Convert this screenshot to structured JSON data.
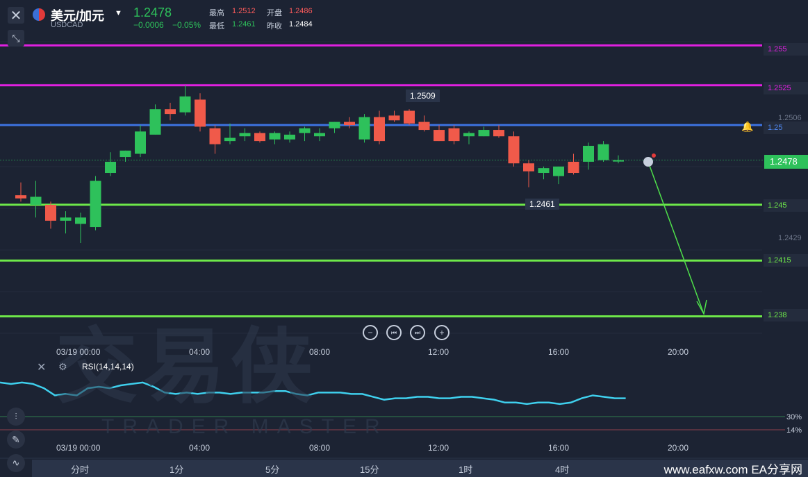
{
  "header": {
    "pair": "美元/加元",
    "symbol": "USDCAD",
    "price": "1.2478",
    "change": "−0.0006",
    "change_pct": "−0.05%",
    "high_label": "最高",
    "high_value": "1.2512",
    "open_label": "开盘",
    "open_value": "1.2486",
    "low_label": "最低",
    "low_value": "1.2461",
    "prev_label": "昨收",
    "prev_value": "1.2484"
  },
  "toolbar": {
    "close_icon": "close-icon",
    "collapse_icon": "collapse-arrows-icon"
  },
  "levels": [
    {
      "label": "1.255",
      "value": 1.255,
      "color": "#e020e0"
    },
    {
      "label": "1.2525",
      "value": 1.2525,
      "color": "#e020e0"
    },
    {
      "label": "1.25",
      "value": 1.25,
      "color": "#3d73e0"
    },
    {
      "label": "1.245",
      "value": 1.245,
      "color": "#6ee84a"
    },
    {
      "label": "1.2415",
      "value": 1.2415,
      "color": "#6ee84a"
    },
    {
      "label": "1.238",
      "value": 1.238,
      "color": "#6ee84a"
    }
  ],
  "price_axis": {
    "tick_1": "1.2506",
    "tick_2": "1.2429",
    "current": "1.2478"
  },
  "annotations": {
    "high": "1.2509",
    "low": "1.2461"
  },
  "time_axis": [
    "03/19 00:00",
    "04:00",
    "08:00",
    "12:00",
    "16:00",
    "20:00"
  ],
  "nav_buttons": [
    "zoom-out",
    "prev",
    "next",
    "zoom-in"
  ],
  "rsi": {
    "label": "RSI(14,14,14)",
    "level_30": "30%",
    "level_14": "14%"
  },
  "tabs": [
    "分时",
    "1分",
    "5分",
    "15分",
    "1时",
    "4时"
  ],
  "watermark": {
    "main": "交易侠",
    "sub": "TRADER MASTER"
  },
  "site": "www.eafxw.com   EA分享网",
  "colors": {
    "up": "#2ec15b",
    "down": "#f05a4a",
    "background": "#1c2333",
    "rsi_line": "#3fd0ee"
  },
  "chart_data": {
    "type": "candlestick",
    "ylim": [
      1.2365,
      1.2565
    ],
    "candles": [
      {
        "o": 1.2456,
        "h": 1.2464,
        "l": 1.2452,
        "c": 1.2454
      },
      {
        "o": 1.245,
        "h": 1.2465,
        "l": 1.2442,
        "c": 1.2455
      },
      {
        "o": 1.245,
        "h": 1.2452,
        "l": 1.2435,
        "c": 1.244
      },
      {
        "o": 1.244,
        "h": 1.2446,
        "l": 1.2432,
        "c": 1.2442
      },
      {
        "o": 1.2438,
        "h": 1.2445,
        "l": 1.2426,
        "c": 1.2442
      },
      {
        "o": 1.2436,
        "h": 1.2468,
        "l": 1.2434,
        "c": 1.2465
      },
      {
        "o": 1.247,
        "h": 1.2483,
        "l": 1.2468,
        "c": 1.2477
      },
      {
        "o": 1.248,
        "h": 1.2484,
        "l": 1.2477,
        "c": 1.2484
      },
      {
        "o": 1.2482,
        "h": 1.25,
        "l": 1.248,
        "c": 1.2496
      },
      {
        "o": 1.2494,
        "h": 1.2513,
        "l": 1.2494,
        "c": 1.251
      },
      {
        "o": 1.251,
        "h": 1.2514,
        "l": 1.2503,
        "c": 1.2507
      },
      {
        "o": 1.2508,
        "h": 1.2525,
        "l": 1.2506,
        "c": 1.2518
      },
      {
        "o": 1.2516,
        "h": 1.252,
        "l": 1.2496,
        "c": 1.2499
      },
      {
        "o": 1.2498,
        "h": 1.25,
        "l": 1.2482,
        "c": 1.2488
      },
      {
        "o": 1.249,
        "h": 1.2501,
        "l": 1.2488,
        "c": 1.2492
      },
      {
        "o": 1.2493,
        "h": 1.2498,
        "l": 1.249,
        "c": 1.2495
      },
      {
        "o": 1.2495,
        "h": 1.2496,
        "l": 1.2489,
        "c": 1.249
      },
      {
        "o": 1.2491,
        "h": 1.2496,
        "l": 1.2488,
        "c": 1.2495
      },
      {
        "o": 1.2491,
        "h": 1.2496,
        "l": 1.2489,
        "c": 1.2494
      },
      {
        "o": 1.2495,
        "h": 1.2499,
        "l": 1.249,
        "c": 1.2498
      },
      {
        "o": 1.2493,
        "h": 1.2498,
        "l": 1.249,
        "c": 1.2495
      },
      {
        "o": 1.2498,
        "h": 1.2502,
        "l": 1.2495,
        "c": 1.2502
      },
      {
        "o": 1.2502,
        "h": 1.2505,
        "l": 1.2498,
        "c": 1.25
      },
      {
        "o": 1.2491,
        "h": 1.2507,
        "l": 1.2489,
        "c": 1.2505
      },
      {
        "o": 1.2505,
        "h": 1.2509,
        "l": 1.2488,
        "c": 1.249
      },
      {
        "o": 1.2506,
        "h": 1.2509,
        "l": 1.2502,
        "c": 1.2503
      },
      {
        "o": 1.2509,
        "h": 1.251,
        "l": 1.25,
        "c": 1.2501
      },
      {
        "o": 1.2502,
        "h": 1.2506,
        "l": 1.2496,
        "c": 1.2497
      },
      {
        "o": 1.2497,
        "h": 1.25,
        "l": 1.249,
        "c": 1.249
      },
      {
        "o": 1.2498,
        "h": 1.25,
        "l": 1.2488,
        "c": 1.249
      },
      {
        "o": 1.2493,
        "h": 1.2496,
        "l": 1.2488,
        "c": 1.2495
      },
      {
        "o": 1.2493,
        "h": 1.2499,
        "l": 1.2493,
        "c": 1.2497
      },
      {
        "o": 1.2497,
        "h": 1.25,
        "l": 1.2492,
        "c": 1.2493
      },
      {
        "o": 1.2493,
        "h": 1.2496,
        "l": 1.2474,
        "c": 1.2476
      },
      {
        "o": 1.2476,
        "h": 1.2478,
        "l": 1.2461,
        "c": 1.2471
      },
      {
        "o": 1.247,
        "h": 1.2474,
        "l": 1.2466,
        "c": 1.2473
      },
      {
        "o": 1.2468,
        "h": 1.2474,
        "l": 1.2463,
        "c": 1.2474
      },
      {
        "o": 1.2477,
        "h": 1.2482,
        "l": 1.2469,
        "c": 1.247
      },
      {
        "o": 1.2477,
        "h": 1.2489,
        "l": 1.2472,
        "c": 1.2487
      },
      {
        "o": 1.2478,
        "h": 1.249,
        "l": 1.2477,
        "c": 1.2488
      },
      {
        "o": 1.2478,
        "h": 1.2481,
        "l": 1.2476,
        "c": 1.2478
      }
    ],
    "rsi": [
      47,
      46,
      47,
      46,
      43,
      38,
      39,
      38,
      43,
      44,
      43,
      45,
      46,
      47,
      44,
      40,
      39,
      40,
      39,
      40,
      40,
      39,
      40,
      40,
      40,
      41,
      41,
      39,
      38,
      40,
      40,
      40,
      39,
      39,
      37,
      35,
      36,
      36,
      37,
      37,
      36,
      36,
      37,
      37,
      36,
      35,
      33,
      33,
      32,
      33,
      33,
      32,
      33,
      36,
      38,
      37,
      36,
      36
    ]
  }
}
